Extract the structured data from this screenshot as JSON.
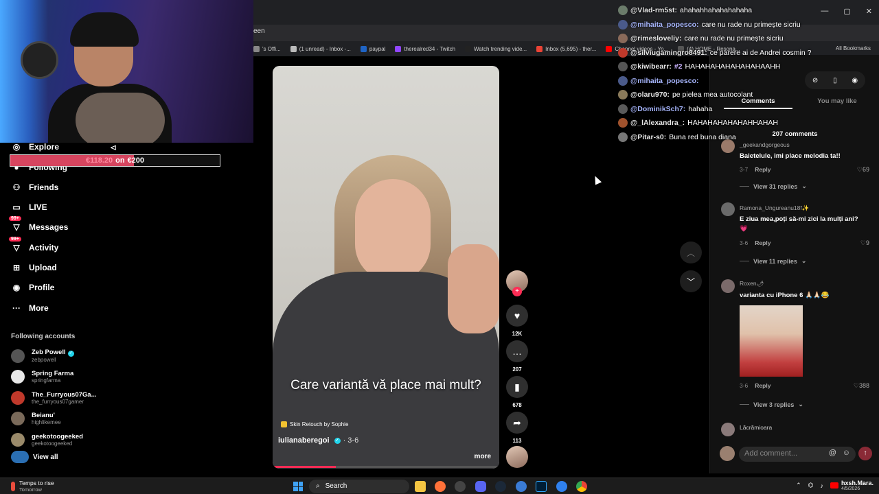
{
  "browser": {
    "url_fragment": "een",
    "bookmarks": [
      {
        "label": "'s Offi...",
        "color": "#888888"
      },
      {
        "label": "(1 unread) - Inbox -...",
        "color": "#bbbbbb"
      },
      {
        "label": "paypal",
        "color": "#1f64c4"
      },
      {
        "label": "therealred34 - Twitch",
        "color": "#9146ff"
      },
      {
        "label": "Watch trending vide...",
        "color": "#222222"
      },
      {
        "label": "Inbox (5,695) - ther...",
        "color": "#ea4335"
      },
      {
        "label": "Channel videos - Yo...",
        "color": "#ff0000"
      },
      {
        "label": "(4) HOME - Resona...",
        "color": "#555555"
      }
    ],
    "all_bookmarks": "All Bookmarks",
    "win_controls": [
      "—",
      "▢",
      "✕"
    ]
  },
  "goal": {
    "current": "€118.20",
    "separator": "on",
    "target": "€200",
    "progress": 0.591
  },
  "sidebar": {
    "items": [
      {
        "label": "Explore",
        "icon": "compass-icon",
        "glyph": "◎",
        "badge": ""
      },
      {
        "label": "Following",
        "icon": "following-icon",
        "glyph": "●",
        "badge": ""
      },
      {
        "label": "Friends",
        "icon": "friends-icon",
        "glyph": "⚇",
        "badge": ""
      },
      {
        "label": "LIVE",
        "icon": "live-icon",
        "glyph": "▭",
        "badge": ""
      },
      {
        "label": "Messages",
        "icon": "messages-icon",
        "glyph": "▽",
        "badge": "99+"
      },
      {
        "label": "Activity",
        "icon": "activity-icon",
        "glyph": "▽",
        "badge": "99+"
      },
      {
        "label": "Upload",
        "icon": "upload-icon",
        "glyph": "⊞",
        "badge": ""
      },
      {
        "label": "Profile",
        "icon": "profile-icon",
        "glyph": "◉",
        "badge": ""
      },
      {
        "label": "More",
        "icon": "more-icon",
        "glyph": "···",
        "badge": ""
      }
    ],
    "following_title": "Following accounts",
    "accounts": [
      {
        "name": "Zeb Powell",
        "user": "zebpowell",
        "verified": true,
        "color": "#555555"
      },
      {
        "name": "Spring Farma",
        "user": "springfarma",
        "verified": false,
        "color": "#e8e8e8"
      },
      {
        "name": "The_Furryous07Ga...",
        "user": "the_furryous07gamer",
        "verified": false,
        "color": "#c0392b"
      },
      {
        "name": "Beianu'",
        "user": "highlikemee",
        "verified": false,
        "color": "#7a6a5a"
      },
      {
        "name": "geekotoogeeked",
        "user": "geekotoogeeked",
        "verified": false,
        "color": "#9a8a6a"
      }
    ],
    "view_all": "View all"
  },
  "video": {
    "caption": "Care variantă vă place mai mult?",
    "effect": "Skin Retouch by Sophie",
    "author": "iulianaberegoi",
    "date": "· 3-6",
    "more": "more",
    "progress": 0.28
  },
  "rail": {
    "likes": "12K",
    "comments": "207",
    "saves": "678",
    "shares": "113"
  },
  "chat": [
    {
      "user": "@Vlad-rm5st:",
      "msg": "ahahahhahahahahaha",
      "color": "#6b7c6b",
      "highlight": false
    },
    {
      "user": "@mihaita_popesco:",
      "msg": "care nu rade nu primește sicriu",
      "color": "#4a5a8a",
      "highlight": true
    },
    {
      "user": "@rimesloveliy:",
      "msg": "care nu rade nu primește sicriu",
      "color": "#8a6a5a",
      "highlight": false
    },
    {
      "user": "@silviugamingro8491:",
      "msg": "ce parere ai de Andrei cosmin ?",
      "color": "#c0392b",
      "highlight": false
    },
    {
      "user": "@kiwibearr:",
      "msg": "HAHAHAHAHAHAHAHAAHH",
      "color": "#555555",
      "highlight": false
    },
    {
      "user": "@mihaita_popesco:",
      "msg": "",
      "color": "#4a5a8a",
      "highlight": true
    },
    {
      "user": "@olaru970:",
      "msg": "pe pielea mea autocolant",
      "color": "#8a7a5a",
      "highlight": false
    },
    {
      "user": "@DominikSch7:",
      "msg": "hahaha",
      "color": "#5a5a5a",
      "highlight": true
    },
    {
      "user": "@_lAlexandra_:",
      "msg": "HAHAHAHAHAHAHHAHAH",
      "color": "#a0522d",
      "highlight": false
    },
    {
      "user": "@Pitar-s0:",
      "msg": "Buna red buna diana",
      "color": "#777777",
      "highlight": false
    }
  ],
  "chat_badge": "#2",
  "comments": {
    "tab_comments": "Comments",
    "tab_like": "You may like",
    "count": "207 comments",
    "items": [
      {
        "user": "_geekandgorgeous",
        "text": "Baietelule, imi place melodia ta!!",
        "date": "3-7",
        "reply": "Reply",
        "likes": "69",
        "replies": "View 31 replies",
        "color": "#9a7a6a"
      },
      {
        "user": "Ramona_Ungureanu18f✨",
        "text": "E ziua mea,poți să-mi zici la mulți ani?💗",
        "date": "3-6",
        "reply": "Reply",
        "likes": "9",
        "replies": "View 11 replies",
        "color": "#6a6a6a"
      },
      {
        "user": "Roxen🌶",
        "text": "varianta cu iPhone 6 🙏🏻🙏🏻😂",
        "date": "3-6",
        "reply": "Reply",
        "likes": "388",
        "replies": "View 3 replies",
        "color": "#7a6a6a"
      },
      {
        "user": "Lăcrămioara",
        "text": "",
        "date": "",
        "reply": "",
        "likes": "",
        "replies": "",
        "color": "#8a7a7a"
      }
    ],
    "add_placeholder": "Add comment..."
  },
  "taskbar": {
    "weather_title": "Temps to rise",
    "weather_sub": "Tomorrow",
    "search": "Search",
    "tray_name": "hxsh.Mara.",
    "tray_date": "4/5/2026"
  }
}
